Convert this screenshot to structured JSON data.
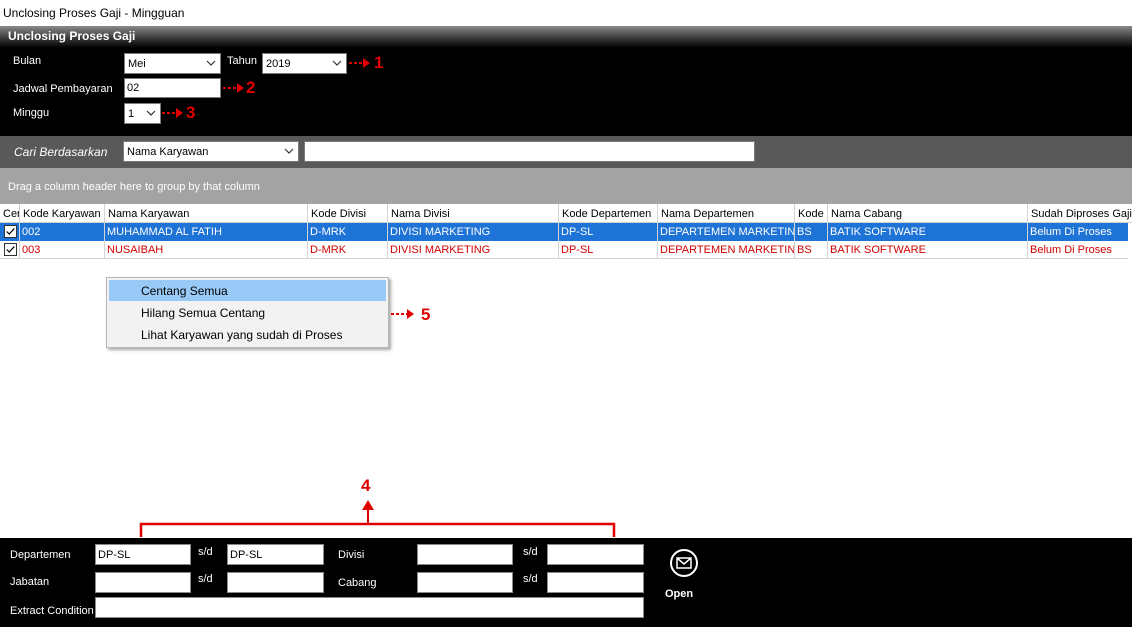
{
  "window": {
    "title": "Unclosing Proses Gaji - Mingguan"
  },
  "panel": {
    "title": "Unclosing Proses Gaji"
  },
  "form": {
    "bulan_label": "Bulan",
    "bulan_value": "Mei",
    "tahun_label": "Tahun",
    "tahun_value": "2019",
    "jadwal_label": "Jadwal Pembayaran",
    "jadwal_value": "02",
    "minggu_label": "Minggu",
    "minggu_value": "1"
  },
  "annotations": {
    "a1": "1",
    "a2": "2",
    "a3": "3",
    "a4": "4",
    "a5": "5"
  },
  "search": {
    "label": "Cari Berdasarkan",
    "field_value": "Nama Karyawan",
    "query": ""
  },
  "group_panel": {
    "hint": "Drag a column header here to group by that column"
  },
  "grid": {
    "columns": [
      "Cen",
      "Kode Karyawan",
      "Nama Karyawan",
      "Kode Divisi",
      "Nama Divisi",
      "Kode Departemen",
      "Nama Departemen",
      "Kode Cabang",
      "Nama Cabang",
      "Sudah Diproses Gaji"
    ],
    "rows": [
      {
        "checked": true,
        "kode_karyawan": "002",
        "nama_karyawan": "MUHAMMAD AL FATIH",
        "kode_divisi": "D-MRK",
        "nama_divisi": "DIVISI MARKETING",
        "kode_departemen": "DP-SL",
        "nama_departemen": "DEPARTEMEN MARKETING",
        "kode_cabang": "BS",
        "nama_cabang": "BATIK SOFTWARE",
        "status": "Belum Di Proses"
      },
      {
        "checked": true,
        "kode_karyawan": "003",
        "nama_karyawan": "NUSAIBAH",
        "kode_divisi": "D-MRK",
        "nama_divisi": "DIVISI MARKETING",
        "kode_departemen": "DP-SL",
        "nama_departemen": "DEPARTEMEN MARKETING",
        "kode_cabang": "BS",
        "nama_cabang": "BATIK SOFTWARE",
        "status": "Belum Di Proses"
      }
    ]
  },
  "context_menu": {
    "items": [
      "Centang Semua",
      "Hilang Semua Centang",
      "Lihat Karyawan yang sudah di Proses"
    ]
  },
  "footer": {
    "departemen_label": "Departemen",
    "departemen_from": "DP-SL",
    "departemen_to": "DP-SL",
    "sd_label": "s/d",
    "divisi_label": "Divisi",
    "divisi_from": "",
    "divisi_to": "",
    "jabatan_label": "Jabatan",
    "jabatan_from": "",
    "jabatan_to": "",
    "cabang_label": "Cabang",
    "cabang_from": "",
    "cabang_to": "",
    "extract_label": "Extract Condition",
    "extract_value": "",
    "open_label": "Open"
  },
  "colors": {
    "selection": "#1e73d6",
    "status_red": "#d10000",
    "annotation": "#e00000",
    "menu_highlight": "#99c9f6"
  }
}
